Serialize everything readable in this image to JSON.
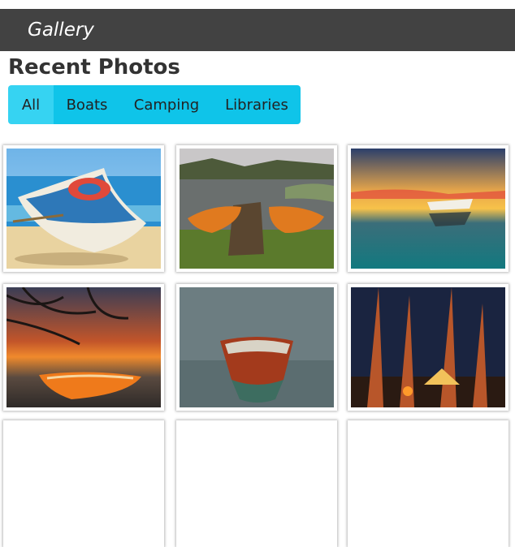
{
  "header": {
    "brand": "Gallery"
  },
  "page": {
    "title": "Recent Photos"
  },
  "filters": [
    {
      "label": "All",
      "active": true
    },
    {
      "label": "Boats",
      "active": false
    },
    {
      "label": "Camping",
      "active": false
    },
    {
      "label": "Libraries",
      "active": false
    }
  ],
  "colors": {
    "header_bg": "#424242",
    "accent": "#0fc4e9",
    "accent_active": "#36d3f2"
  },
  "photos": [
    {
      "subject": "white rowboat with life ring on sandy beach"
    },
    {
      "subject": "two orange rowboats beside wooden pier on lake"
    },
    {
      "subject": "small boat reflected on calm water at sunset"
    },
    {
      "subject": "orange boat on shore under tree branches at sunset"
    },
    {
      "subject": "wooden motorboat on still grey water"
    },
    {
      "subject": "lit tent in forest at night under tall pines"
    }
  ]
}
